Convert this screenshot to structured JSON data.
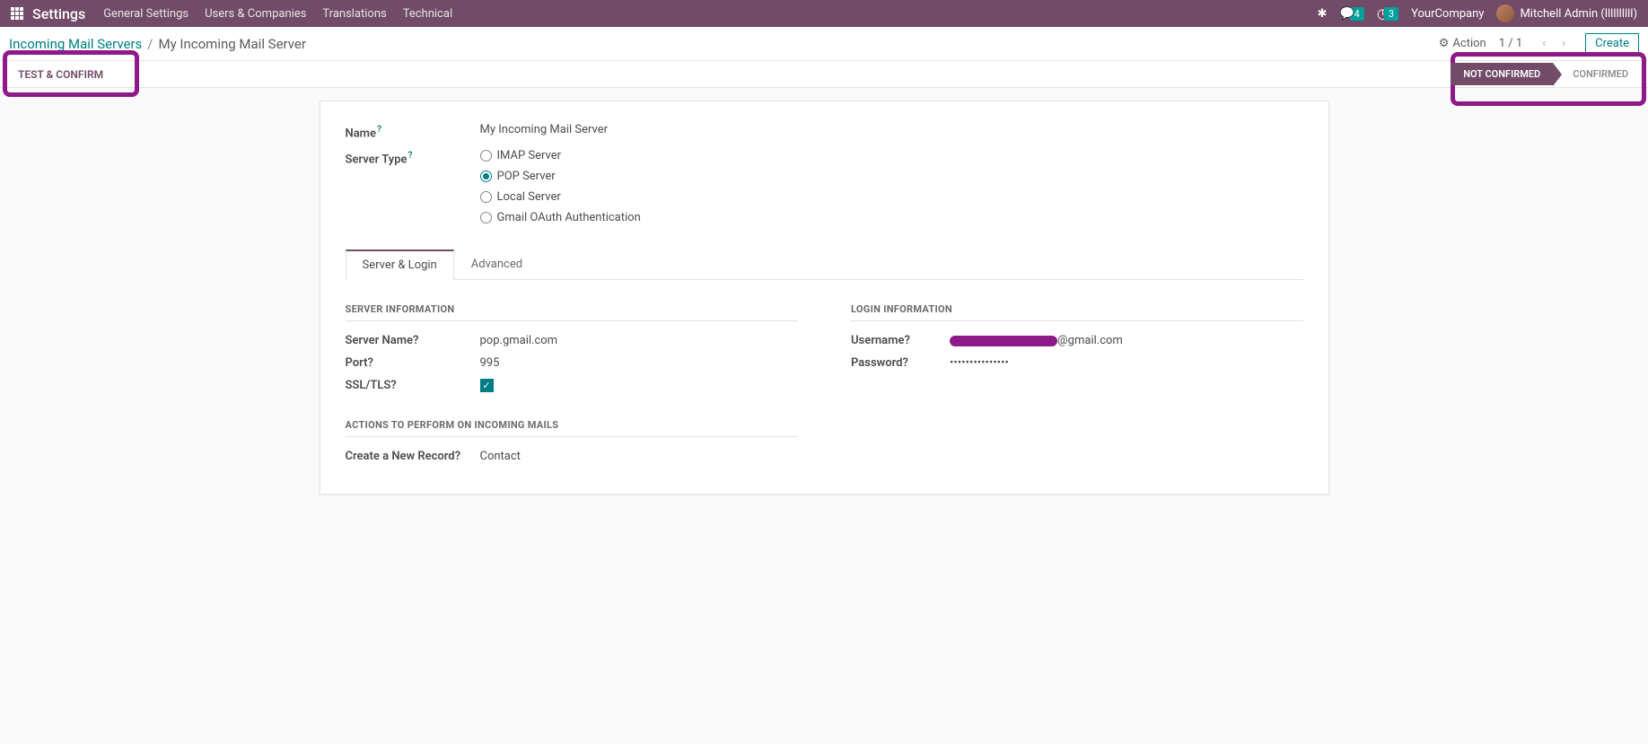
{
  "nav": {
    "title": "Settings",
    "menu": [
      "General Settings",
      "Users & Companies",
      "Translations",
      "Technical"
    ],
    "chat_badge": "4",
    "clock_badge": "3",
    "company": "YourCompany",
    "user": "Mitchell Admin (llllllllll)"
  },
  "breadcrumb": {
    "link": "Incoming Mail Servers",
    "current": "My Incoming Mail Server"
  },
  "actions": {
    "action_label": "Action",
    "pager": "1 / 1",
    "create_label": "Create"
  },
  "buttons": {
    "test_confirm": "TEST & CONFIRM"
  },
  "status": {
    "not_confirmed": "NOT CONFIRMED",
    "confirmed": "CONFIRMED"
  },
  "form": {
    "name_label": "Name",
    "name_value": "My Incoming Mail Server",
    "server_type_label": "Server Type",
    "server_types": {
      "imap": "IMAP Server",
      "pop": "POP Server",
      "local": "Local Server",
      "gmail": "Gmail OAuth Authentication"
    }
  },
  "tabs": {
    "server_login": "Server & Login",
    "advanced": "Advanced"
  },
  "server_info": {
    "title": "SERVER INFORMATION",
    "server_name_label": "Server Name",
    "server_name_value": "pop.gmail.com",
    "port_label": "Port",
    "port_value": "995",
    "ssl_label": "SSL/TLS"
  },
  "login_info": {
    "title": "LOGIN INFORMATION",
    "username_label": "Username",
    "username_suffix": "@gmail.com",
    "password_label": "Password",
    "password_value": "•••••••••••••••"
  },
  "actions_section": {
    "title": "ACTIONS TO PERFORM ON INCOMING MAILS",
    "create_record_label": "Create a New Record",
    "create_record_value": "Contact"
  }
}
